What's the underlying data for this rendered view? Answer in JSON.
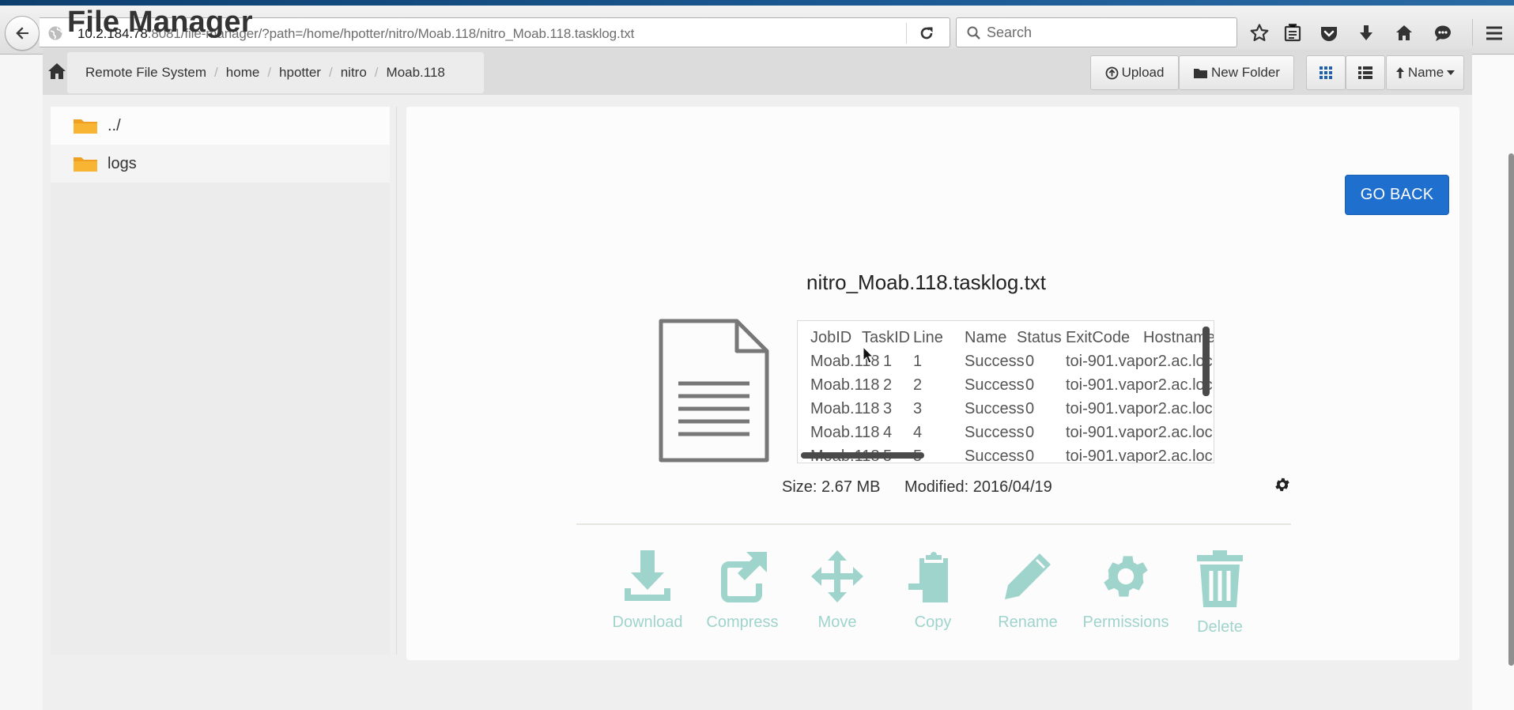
{
  "browser": {
    "url_host": "10.2.184.78",
    "url_rest": ":8081/file-manager/?path=/home/hpotter/nitro/Moab.118/nitro_Moab.118.tasklog.txt",
    "search_placeholder": "Search",
    "toolbar_icons": [
      "star-icon",
      "reading-list-icon",
      "pocket-icon",
      "download-arrow-icon",
      "home-icon",
      "chat-icon",
      "hamburger-menu-icon"
    ]
  },
  "app": {
    "title": "File Manager"
  },
  "breadcrumb": [
    "Remote File System",
    "home",
    "hpotter",
    "nitro",
    "Moab.118"
  ],
  "toolbar": {
    "upload_label": "Upload",
    "new_folder_label": "New Folder",
    "sort_label": "Name"
  },
  "sidebar": {
    "items": [
      {
        "label": "../",
        "icon": "folder-icon"
      },
      {
        "label": "logs",
        "icon": "folder-icon"
      }
    ]
  },
  "detail": {
    "go_back_label": "GO BACK",
    "filename": "nitro_Moab.118.tasklog.txt",
    "size": "Size: 2.67 MB",
    "modified": "Modified: 2016/04/19"
  },
  "preview": {
    "columns": [
      "JobID",
      "TaskID",
      "Line",
      "Name",
      "Status",
      "ExitCode",
      "Hostname"
    ],
    "rows": [
      [
        "Moab.118",
        "1",
        "1",
        "",
        "Success",
        "0",
        "toi-901.vapor2.ac.loc"
      ],
      [
        "Moab.118",
        "2",
        "2",
        "",
        "Success",
        "0",
        "toi-901.vapor2.ac.loc"
      ],
      [
        "Moab.118",
        "3",
        "3",
        "",
        "Success",
        "0",
        "toi-901.vapor2.ac.loc"
      ],
      [
        "Moab.118",
        "4",
        "4",
        "",
        "Success",
        "0",
        "toi-901.vapor2.ac.loc"
      ],
      [
        "Moab.118",
        "5",
        "5",
        "",
        "Success",
        "0",
        "toi-901.vapor2.ac.loc"
      ]
    ]
  },
  "actions": [
    {
      "label": "Download",
      "icon": "download-icon"
    },
    {
      "label": "Compress",
      "icon": "compress-icon"
    },
    {
      "label": "Move",
      "icon": "move-icon"
    },
    {
      "label": "Copy",
      "icon": "copy-icon"
    },
    {
      "label": "Rename",
      "icon": "rename-icon"
    },
    {
      "label": "Permissions",
      "icon": "permissions-icon"
    },
    {
      "label": "Delete",
      "icon": "delete-icon"
    }
  ],
  "colors": {
    "primary_button": "#1f6fcf",
    "action_icon": "#9fd4cc",
    "folder": "#f0a020"
  }
}
